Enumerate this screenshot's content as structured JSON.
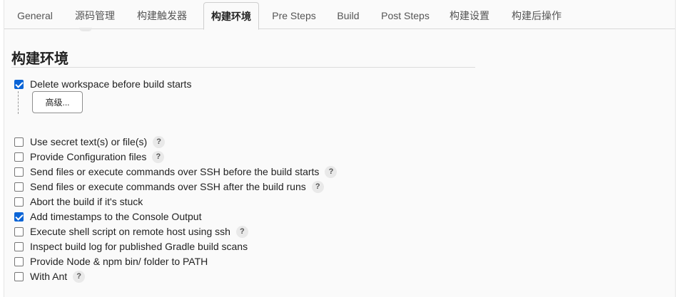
{
  "tabs": [
    {
      "label": "General",
      "active": false
    },
    {
      "label": "源码管理",
      "active": false
    },
    {
      "label": "构建触发器",
      "active": false
    },
    {
      "label": "构建环境",
      "active": true
    },
    {
      "label": "Pre Steps",
      "active": false
    },
    {
      "label": "Build",
      "active": false
    },
    {
      "label": "Post Steps",
      "active": false
    },
    {
      "label": "构建设置",
      "active": false
    },
    {
      "label": "构建后操作",
      "active": false
    }
  ],
  "section": {
    "title": "构建环境"
  },
  "options": [
    {
      "label": "Delete workspace before build starts",
      "checked": true,
      "has_help": false
    },
    {
      "label": "Use secret text(s) or file(s)",
      "checked": false,
      "has_help": true
    },
    {
      "label": "Provide Configuration files",
      "checked": false,
      "has_help": true
    },
    {
      "label": "Send files or execute commands over SSH before the build starts",
      "checked": false,
      "has_help": true
    },
    {
      "label": "Send files or execute commands over SSH after the build runs",
      "checked": false,
      "has_help": true
    },
    {
      "label": "Abort the build if it's stuck",
      "checked": false,
      "has_help": false
    },
    {
      "label": "Add timestamps to the Console Output",
      "checked": true,
      "has_help": false
    },
    {
      "label": "Execute shell script on remote host using ssh",
      "checked": false,
      "has_help": true
    },
    {
      "label": "Inspect build log for published Gradle build scans",
      "checked": false,
      "has_help": false
    },
    {
      "label": "Provide Node & npm bin/ folder to PATH",
      "checked": false,
      "has_help": false
    },
    {
      "label": "With Ant",
      "checked": false,
      "has_help": true
    }
  ],
  "advanced_button": {
    "label": "高级..."
  },
  "help_glyph": "?",
  "colors": {
    "accent": "#0a64d6",
    "background": "#fafafa"
  },
  "icons": {
    "help": "question-mark-icon",
    "checkbox": "checkbox-icon"
  }
}
